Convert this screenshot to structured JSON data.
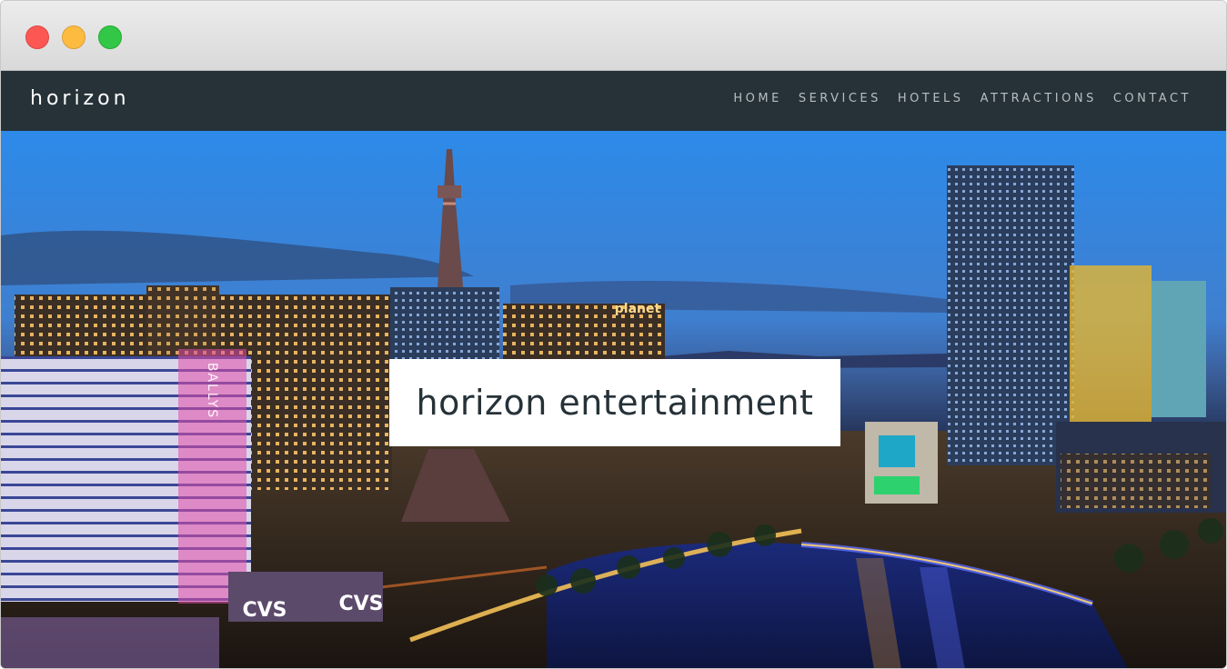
{
  "window": {
    "controls": [
      "close",
      "minimize",
      "maximize"
    ]
  },
  "nav": {
    "brand": "horizon",
    "links": [
      "HOME",
      "SERVICES",
      "HOTELS",
      "ATTRACTIONS",
      "CONTACT"
    ]
  },
  "hero": {
    "title": "horizon entertainment",
    "sign_ballys": "BALLYS",
    "sign_cvs": "CVS",
    "sign_planet": "planet"
  },
  "colors": {
    "navbar": "#263238",
    "nav_link": "#b7bec3",
    "title_text": "#263238"
  }
}
